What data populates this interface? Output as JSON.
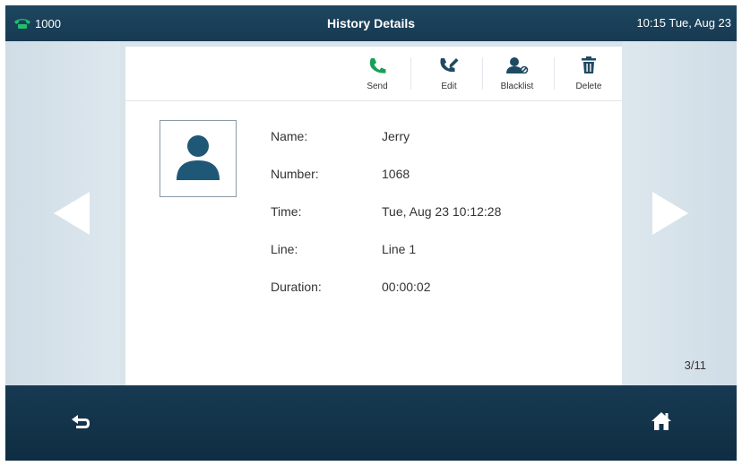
{
  "status_bar": {
    "line_account": "1000",
    "title": "History Details",
    "datetime": "10:15 Tue, Aug 23"
  },
  "toolbar": {
    "send_label": "Send",
    "edit_label": "Edit",
    "blacklist_label": "Blacklist",
    "delete_label": "Delete"
  },
  "details": {
    "name_label": "Name:",
    "name_value": "Jerry",
    "number_label": "Number:",
    "number_value": "1068",
    "time_label": "Time:",
    "time_value": "Tue, Aug 23 10:12:28",
    "line_label": "Line:",
    "line_value": "Line 1",
    "duration_label": "Duration:",
    "duration_value": "00:00:02"
  },
  "pagination": {
    "text": "3/11"
  },
  "icons": {
    "line_status": "phone-handset-icon",
    "send": "phone-icon",
    "edit": "phone-edit-icon",
    "blacklist": "user-block-icon",
    "delete": "trash-icon",
    "avatar": "user-silhouette-icon",
    "prev": "arrow-left-icon",
    "next": "arrow-right-icon",
    "back": "back-icon",
    "home": "home-icon"
  },
  "colors": {
    "accent_green": "#18a05a",
    "icon_dark": "#1f4a62",
    "bar_bg": "#173a52"
  }
}
